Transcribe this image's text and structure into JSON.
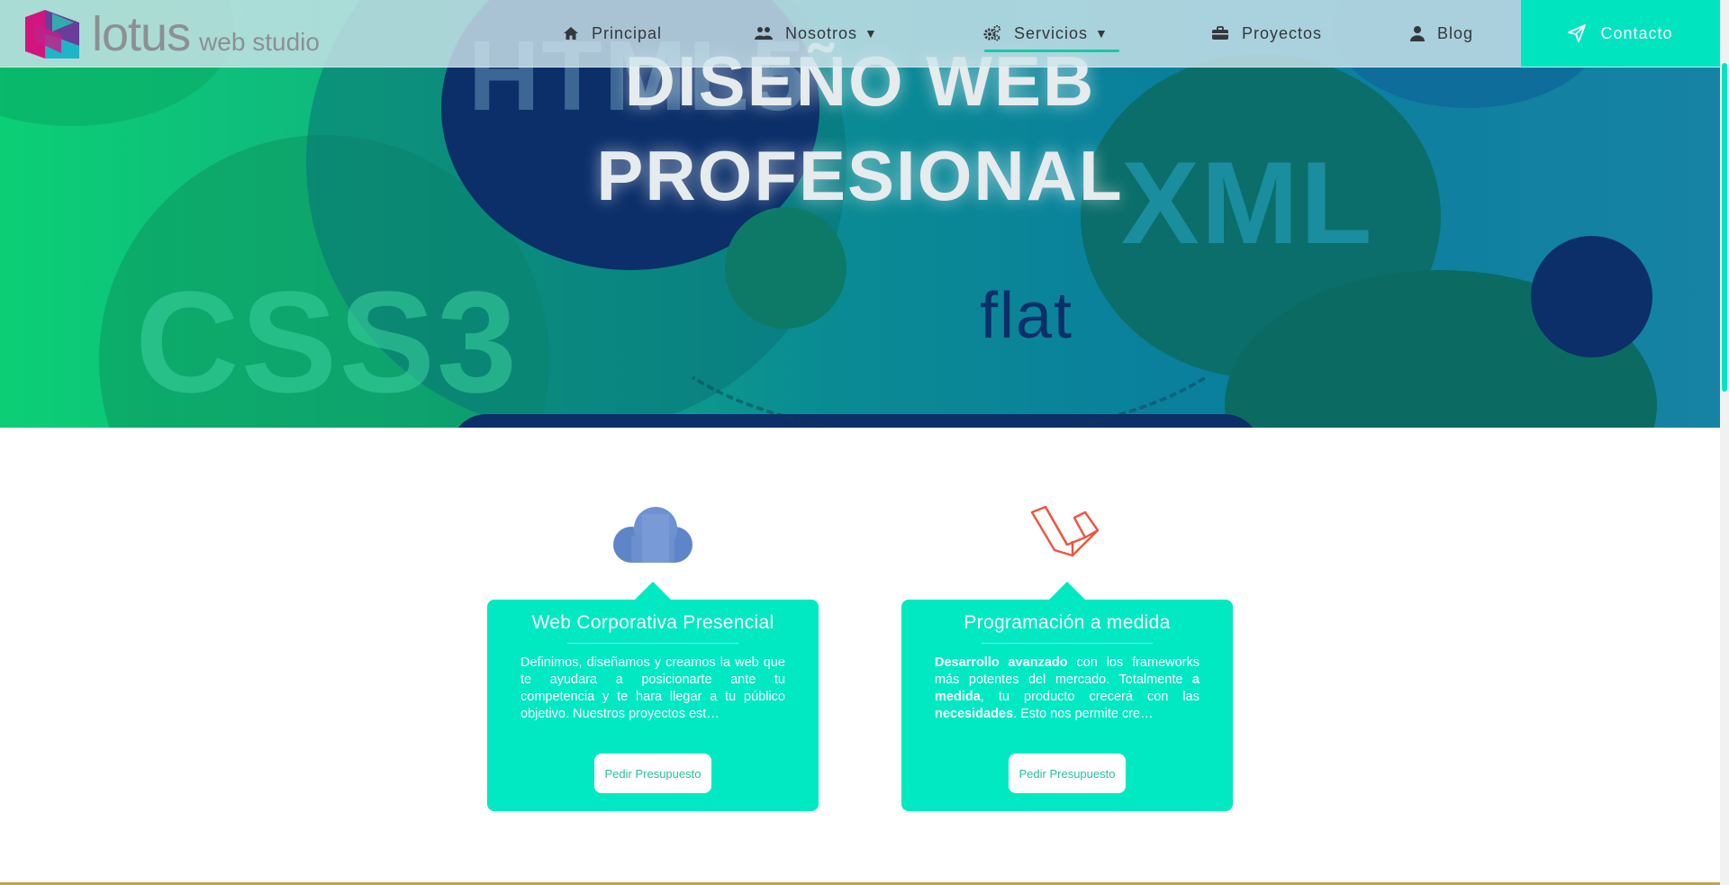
{
  "brand": {
    "name": "lotus",
    "sub": "web studio"
  },
  "nav": {
    "items": [
      {
        "label": "Principal",
        "icon": "home-icon"
      },
      {
        "label": "Nosotros",
        "icon": "users-icon",
        "caret": "▼"
      },
      {
        "label": "Servicios",
        "icon": "gears-icon",
        "caret": "▼",
        "active": true
      },
      {
        "label": "Proyectos",
        "icon": "briefcase-icon"
      },
      {
        "label": "Blog",
        "icon": "user-icon"
      }
    ],
    "contact": {
      "label": "Contacto",
      "icon": "paper-plane-icon"
    }
  },
  "hero": {
    "title_line1": "DISEÑO WEB",
    "title_line2": "PROFESIONAL",
    "bg_words": {
      "css": "CSS3",
      "html": "HTML5",
      "xml": "XML",
      "flat": "flat"
    }
  },
  "services": [
    {
      "icon": "cloud-icon",
      "title": "Web Corporativa Presencial",
      "text_html": "Definimos, diseñamos y creamos la web que te ayudara a posicionarte ante tu competencia y te hara llegar a tu público objetivo. Nuestros proyectos est…",
      "button": "Pedir Presupuesto"
    },
    {
      "icon": "laravel-icon",
      "title": "Programación a medida",
      "text_parts": [
        {
          "t": "Desarrollo avanzado",
          "b": true
        },
        {
          "t": " con los frameworks más potentes del mercado. Totalmente ",
          "b": false
        },
        {
          "t": "a medida",
          "b": true
        },
        {
          "t": ", tu producto crecerá con las ",
          "b": false
        },
        {
          "t": "necesidades",
          "b": true
        },
        {
          "t": ". Esto nos permite cre…",
          "b": false
        }
      ],
      "button": "Pedir Presupuesto"
    }
  ],
  "colors": {
    "accent": "#00e5c0",
    "card": "#00e9c2",
    "nav_text": "#33383d",
    "logo_gray": "#8d8f93"
  }
}
